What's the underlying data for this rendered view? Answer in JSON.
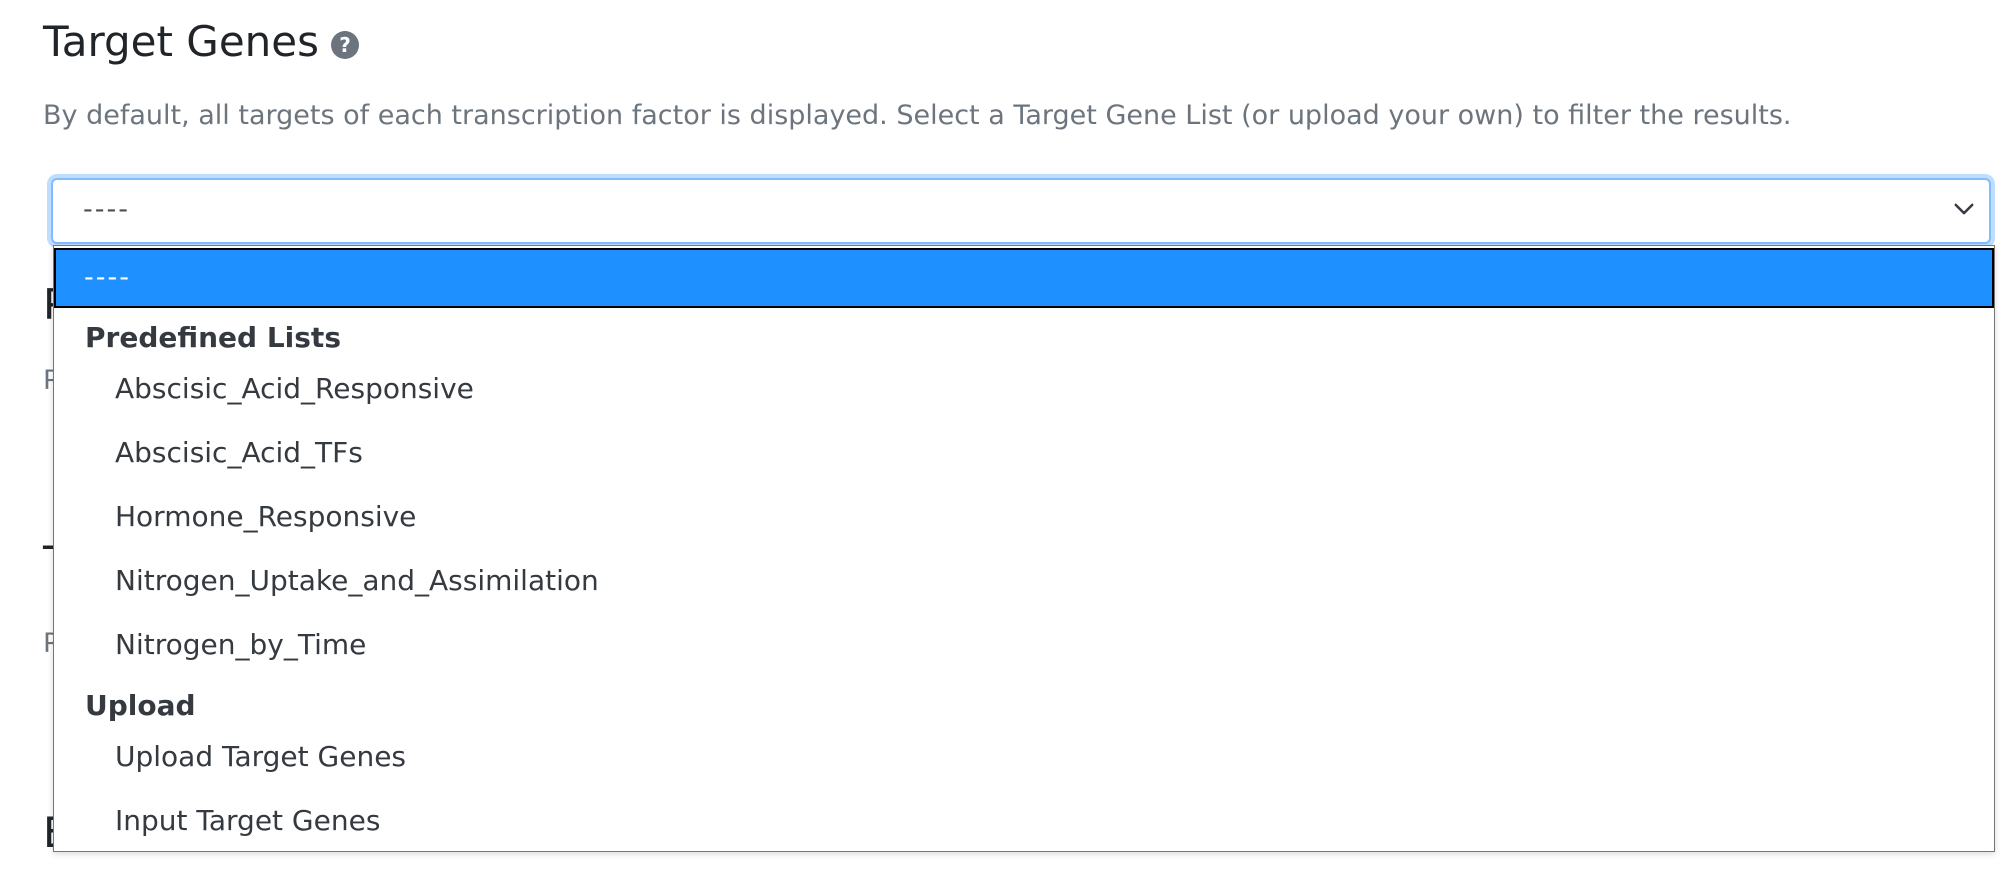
{
  "header": {
    "title": "Target Genes",
    "help_icon": "question-circle-icon"
  },
  "description": "By default, all targets of each transcription factor is displayed. Select a Target Gene List (or upload your own) to filter the results.",
  "select": {
    "value": "----",
    "icon": "chevron-down-icon",
    "accent_color": "#80bdff"
  },
  "dropdown": {
    "selected_option": "----",
    "highlight_color": "#1e90ff",
    "groups": [
      {
        "label": "Predefined Lists",
        "options": [
          "Abscisic_Acid_Responsive",
          "Abscisic_Acid_TFs",
          "Hormone_Responsive",
          "Nitrogen_Uptake_and_Assimilation",
          "Nitrogen_by_Time"
        ]
      },
      {
        "label": "Upload",
        "options": [
          "Upload Target Genes",
          "Input Target Genes"
        ]
      }
    ]
  }
}
